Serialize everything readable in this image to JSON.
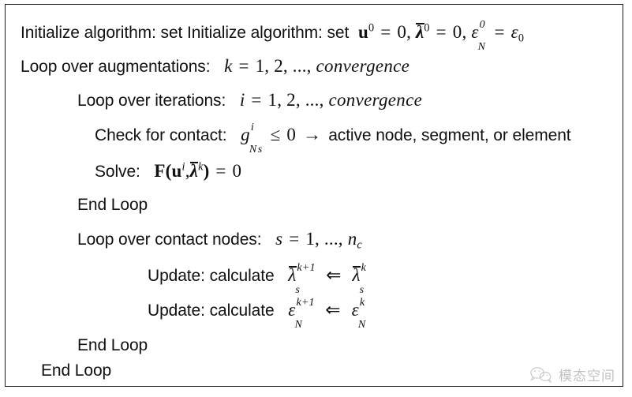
{
  "document": {
    "type": "algorithm-pseudocode-box",
    "background_color": "#ffffff",
    "border_color": "#1a1a1a",
    "text_color": "#111111"
  },
  "algorithm": {
    "lines": [
      {
        "id": "initialize",
        "indent": 0,
        "label": "Initialize algorithm: set Initialize algorithm: set",
        "math_plain": "u^0 = 0, λ̄0 = 0, ε_N^0 = ε_0"
      },
      {
        "id": "loop-augmentations",
        "indent": 0,
        "label": "Loop over augmentations:",
        "math_plain": "k = 1, 2, ..., convergence",
        "math_var": "k",
        "math_list": "1, 2, ...,",
        "math_word": "convergence"
      },
      {
        "id": "loop-iterations",
        "indent": 1,
        "label": "Loop over iterations:",
        "math_plain": "i = 1, 2, ..., convergence",
        "math_var": "i",
        "math_list": "1, 2, ...,",
        "math_word": "convergence"
      },
      {
        "id": "check-contact",
        "indent": 2,
        "label": "Check for contact:",
        "math_plain": "g_Ns^i ≤ 0",
        "trailing_text": "active node, segment, or element",
        "arrow": "→"
      },
      {
        "id": "solve",
        "indent": 2,
        "label": "Solve:",
        "math_plain": "F(u^i, λ̄^k) = 0"
      },
      {
        "id": "end-loop-iterations",
        "indent": 1,
        "label": "End Loop",
        "math_plain": ""
      },
      {
        "id": "loop-contact-nodes",
        "indent": 1,
        "label": "Loop over contact nodes:",
        "math_plain": "s = 1, ..., n_c",
        "math_var": "s",
        "math_list": "1, ...,"
      },
      {
        "id": "update-lambda",
        "indent": 3,
        "label": "Update: calculate",
        "math_plain": "λ̄_s^{k+1} ⇐ λ̄_s^k"
      },
      {
        "id": "update-epsilon",
        "indent": 3,
        "label": "Update: calculate",
        "math_plain": "ε_N^{k+1} ⇐ ε_N^k"
      },
      {
        "id": "end-loop-contact-nodes",
        "indent": 1,
        "label": "End Loop",
        "math_plain": ""
      },
      {
        "id": "end-loop-augmentations",
        "indent": 0,
        "label": "End Loop",
        "math_plain": ""
      }
    ],
    "symbols": {
      "zero": "0",
      "one": "1",
      "two": "2",
      "ellipsis": "...",
      "equals": "=",
      "leq": "≤",
      "rightarrow": "→",
      "double_left_arrow": "⇐",
      "comma": ",",
      "u": "u",
      "lambda": "λ",
      "epsilon": "ε",
      "bold_F": "F",
      "n": "n",
      "g": "g",
      "sub_N": "N",
      "sub_s": "s",
      "sub_c": "c",
      "sup_0": "0",
      "sup_i": "i",
      "sup_k": "k",
      "sup_k_plus_1": "k+1",
      "sub_zero": "0",
      "convergence": "convergence",
      "lparen": "(",
      "rparen": ")"
    }
  },
  "watermark": {
    "text": "模态空间",
    "icon": "wechat-icon",
    "color": "#8a8a8a"
  }
}
